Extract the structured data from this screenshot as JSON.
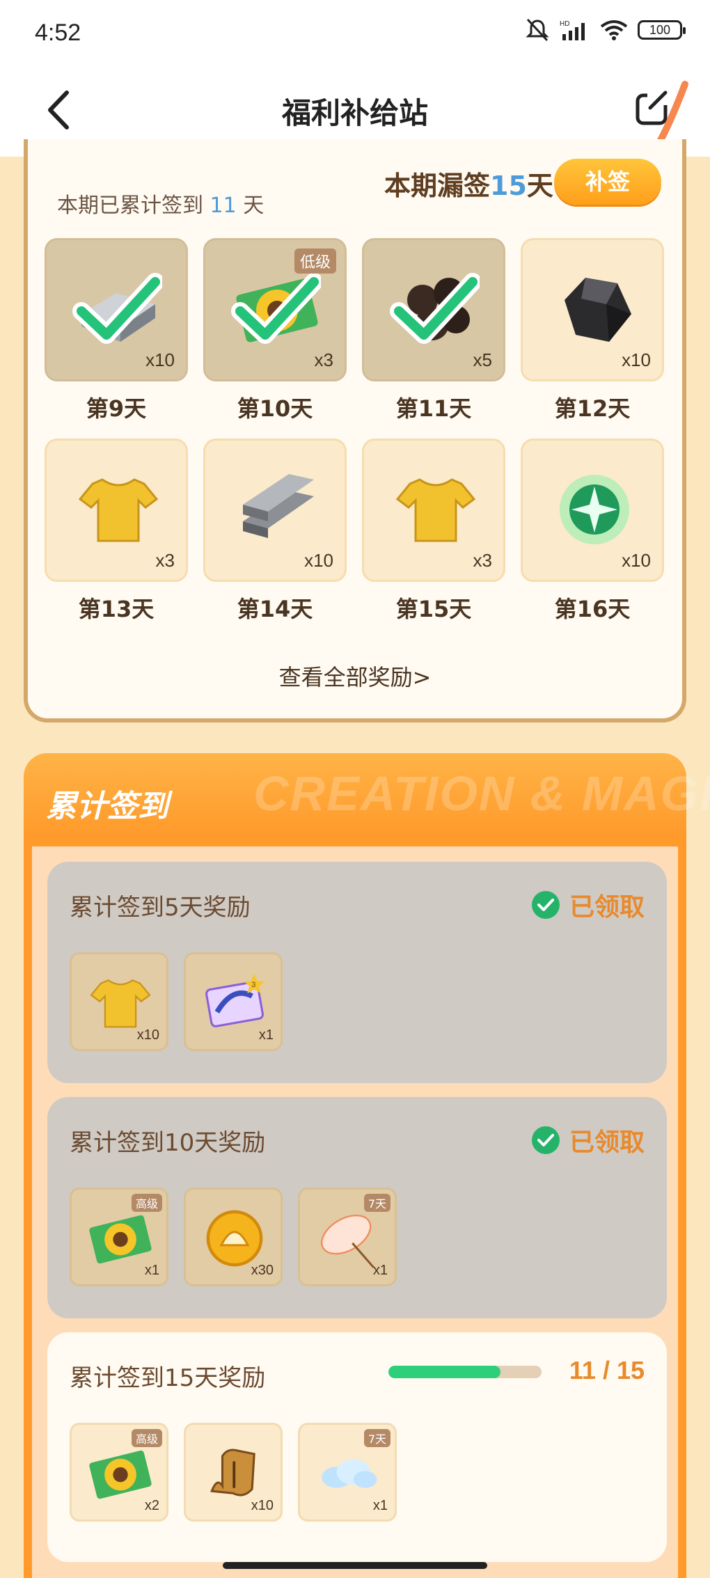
{
  "status_bar": {
    "time": "4:52",
    "battery": "100"
  },
  "header": {
    "title": "福利补给站"
  },
  "daily_signin": {
    "accum_prefix": "本期已累计签到",
    "accum_count": "11",
    "accum_suffix": "天",
    "missed_prefix": "本期漏签",
    "missed_count": "15",
    "missed_suffix": "天",
    "makeup_label": "补签",
    "days": [
      {
        "label": "第9天",
        "qty": "x10",
        "claimed": true,
        "icon": "silver-ingot-icon"
      },
      {
        "label": "第10天",
        "qty": "x3",
        "claimed": true,
        "tag": "低级",
        "icon": "sunflower-ticket-icon"
      },
      {
        "label": "第11天",
        "qty": "x5",
        "claimed": true,
        "icon": "black-beans-icon"
      },
      {
        "label": "第12天",
        "qty": "x10",
        "claimed": false,
        "icon": "black-ore-icon"
      },
      {
        "label": "第13天",
        "qty": "x3",
        "claimed": false,
        "icon": "gold-shirt-icon"
      },
      {
        "label": "第14天",
        "qty": "x10",
        "claimed": false,
        "icon": "metal-bars-icon"
      },
      {
        "label": "第15天",
        "qty": "x3",
        "claimed": false,
        "icon": "gold-shirt-icon"
      },
      {
        "label": "第16天",
        "qty": "x10",
        "claimed": false,
        "icon": "green-orb-icon"
      }
    ],
    "view_all": "查看全部奖励>"
  },
  "cumulative": {
    "title": "累计签到",
    "watermark": "CREATION & MAGIC",
    "rewards": [
      {
        "title": "累计签到5天奖励",
        "status": "已领取",
        "items": [
          {
            "qty": "x10",
            "icon": "gold-shirt-icon"
          },
          {
            "qty": "x1",
            "icon": "card-icon",
            "tag": "3"
          }
        ]
      },
      {
        "title": "累计签到10天奖励",
        "status": "已领取",
        "items": [
          {
            "qty": "x1",
            "icon": "sunflower-ticket-icon",
            "tag": "高级"
          },
          {
            "qty": "x30",
            "icon": "shell-coin-icon"
          },
          {
            "qty": "x1",
            "icon": "umbrella-icon",
            "tag": "7天"
          }
        ]
      },
      {
        "title": "累计签到15天奖励",
        "progress_text": "11 / 15",
        "progress": 0.733,
        "items": [
          {
            "qty": "x2",
            "icon": "sunflower-ticket-icon",
            "tag": "高级"
          },
          {
            "qty": "x10",
            "icon": "scroll-icon"
          },
          {
            "qty": "x1",
            "icon": "cloud-icon",
            "tag": "7天"
          }
        ]
      }
    ]
  },
  "colors": {
    "accent": "#ff9f1a",
    "blue_num": "#4f9ad9",
    "green": "#2ecf7a",
    "claimed_text": "#e88a2c"
  }
}
